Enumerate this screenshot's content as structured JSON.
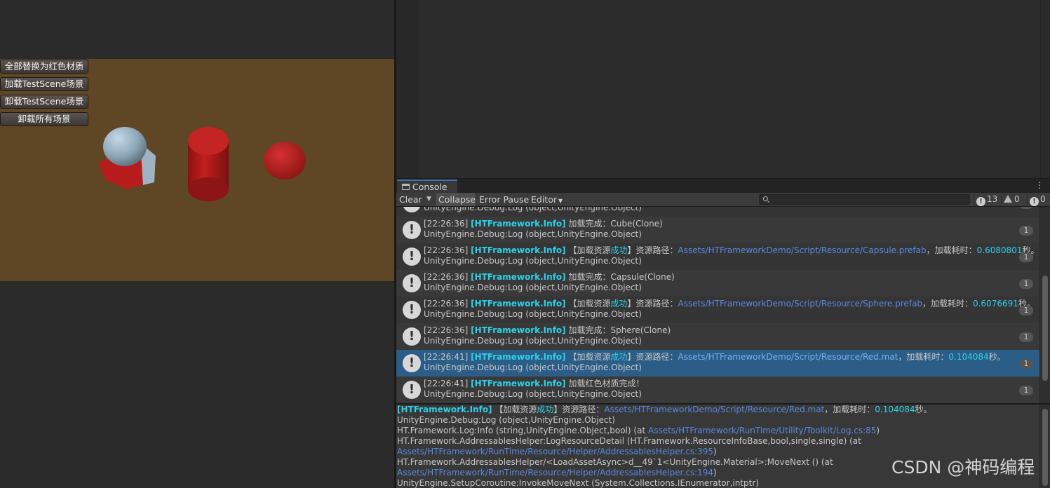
{
  "game": {
    "floor_color": "#5f4624",
    "buttons": [
      {
        "label": "全部替换为红色材质"
      },
      {
        "label": "加载TestScene场景"
      },
      {
        "label": "卸载TestScene场景"
      },
      {
        "label": "卸载所有场景"
      }
    ],
    "objects": [
      "cube-with-sphere",
      "capsule",
      "sphere"
    ]
  },
  "console": {
    "tab_label": "Console",
    "toolbar": {
      "clear": "Clear",
      "collapse": "Collapse",
      "error_pause": "Error Pause",
      "editor": "Editor",
      "search_placeholder": "",
      "info_count": "13",
      "warning_count": "0",
      "error_count": "0"
    },
    "rows": [
      {
        "time": "[22:26:36]",
        "tag": "[HTFramework.Info]",
        "pre": " 加载完成：Cube(Clone)",
        "hl1": "",
        "mid": "",
        "path": "",
        "post": "",
        "hl2": "",
        "end": "",
        "line2": "UnityEngine.Debug:Log (object,UnityEngine.Object)",
        "count": "1"
      },
      {
        "time": "[22:26:36]",
        "tag": "[HTFramework.Info]",
        "pre": " 【加载资源",
        "hl1": "成功",
        "mid": "】资源路径：",
        "path": "Assets/HTFrameworkDemo/Script/Resource/Capsule.prefab",
        "post": "，加载耗时：",
        "hl2": "0.6080801",
        "end": "秒。",
        "line2": "UnityEngine.Debug:Log (object,UnityEngine.Object)",
        "count": "1"
      },
      {
        "time": "[22:26:36]",
        "tag": "[HTFramework.Info]",
        "pre": " 加载完成：Capsule(Clone)",
        "hl1": "",
        "mid": "",
        "path": "",
        "post": "",
        "hl2": "",
        "end": "",
        "line2": "UnityEngine.Debug:Log (object,UnityEngine.Object)",
        "count": "1"
      },
      {
        "time": "[22:26:36]",
        "tag": "[HTFramework.Info]",
        "pre": " 【加载资源",
        "hl1": "成功",
        "mid": "】资源路径：",
        "path": "Assets/HTFrameworkDemo/Script/Resource/Sphere.prefab",
        "post": "，加载耗时：",
        "hl2": "0.6076691",
        "end": "秒。",
        "line2": "UnityEngine.Debug:Log (object,UnityEngine.Object)",
        "count": "1"
      },
      {
        "time": "[22:26:36]",
        "tag": "[HTFramework.Info]",
        "pre": " 加载完成：Sphere(Clone)",
        "hl1": "",
        "mid": "",
        "path": "",
        "post": "",
        "hl2": "",
        "end": "",
        "line2": "UnityEngine.Debug:Log (object,UnityEngine.Object)",
        "count": "1"
      },
      {
        "time": "[22:26:41]",
        "tag": "[HTFramework.Info]",
        "pre": " 【加载资源",
        "hl1": "成功",
        "mid": "】资源路径：",
        "path": "Assets/HTFrameworkDemo/Script/Resource/Red.mat",
        "post": "，加载耗时：",
        "hl2": "0.104084",
        "end": "秒。",
        "line2": "UnityEngine.Debug:Log (object,UnityEngine.Object)",
        "count": "1"
      },
      {
        "time": "[22:26:41]",
        "tag": "[HTFramework.Info]",
        "pre": " 加载红色材质完成！",
        "hl1": "",
        "mid": "",
        "path": "",
        "post": "",
        "hl2": "",
        "end": "",
        "line2": "UnityEngine.Debug:Log (object,UnityEngine.Object)",
        "count": "1"
      }
    ],
    "partial_row": {
      "line2": "UnityEngine.Debug:Log (object,UnityEngine.Object)",
      "count": "1"
    },
    "detail": {
      "tag": "[HTFramework.Info]",
      "l1_pre": " 【加载资源",
      "l1_hl": "成功",
      "l1_mid": "】资源路径：",
      "l1_path": "Assets/HTFrameworkDemo/Script/Resource/Red.mat",
      "l1_post": "，加载耗时：",
      "l1_hl2": "0.104084",
      "l1_end": "秒。",
      "l2": "UnityEngine.Debug:Log (object,UnityEngine.Object)",
      "l3_pre": "HT.Framework.Log:Info (string,UnityEngine.Object,bool) (at ",
      "l3_path": "Assets/HTFramework/RunTime/Utility/Toolkit/Log.cs:85",
      "l3_post": ")",
      "l4": "HT.Framework.AddressablesHelper:LogResourceDetail (HT.Framework.ResourceInfoBase,bool,single,single) (at",
      "l5_path": "Assets/HTFramework/RunTime/Resource/Helper/AddressablesHelper.cs:395",
      "l5_post": ")",
      "l6": "HT.Framework.AddressablesHelper/<LoadAssetAsync>d__49`1<UnityEngine.Material>:MoveNext () (at",
      "l7_path": "Assets/HTFramework/RunTime/Resource/Helper/AddressablesHelper.cs:194",
      "l7_post": ")",
      "l8": "UnityEngine.SetupCoroutine:InvokeMoveNext (System.Collections.IEnumerator,intptr)"
    }
  },
  "watermark": "CSDN @神码编程"
}
